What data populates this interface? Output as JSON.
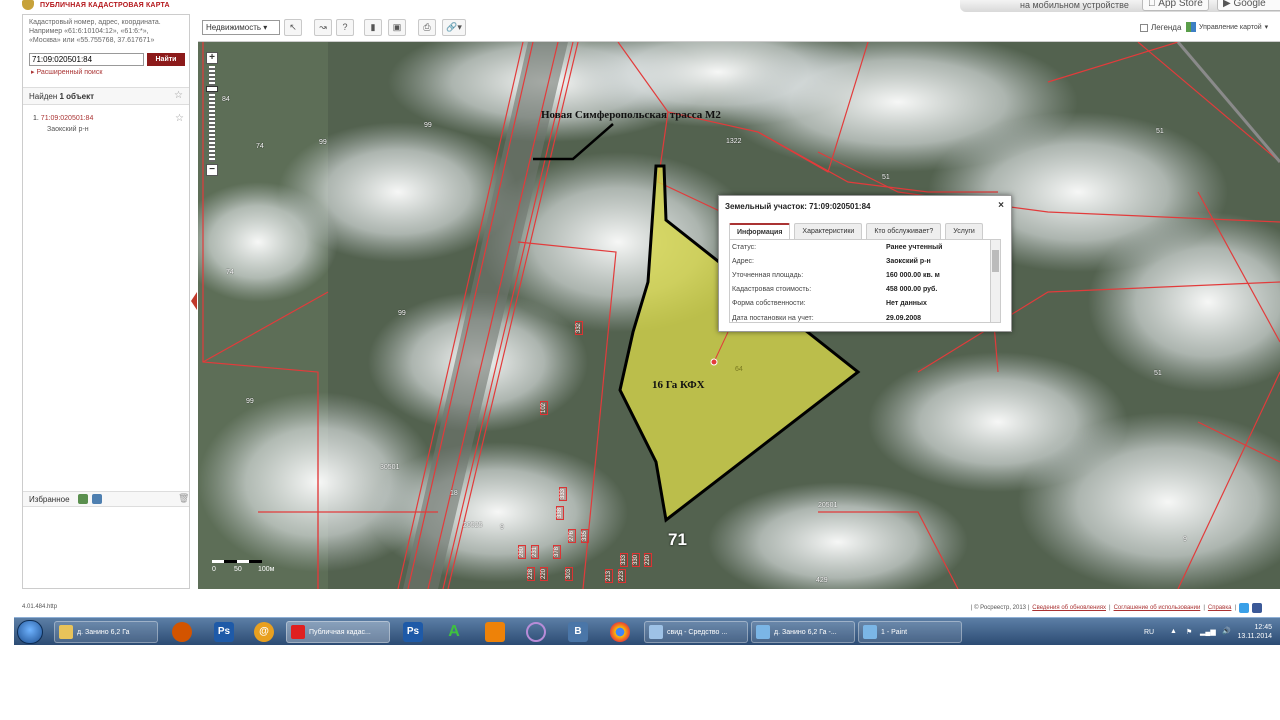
{
  "header": {
    "logo_text": "ПУБЛИЧНАЯ КАДАСТРОВАЯ КАРТА",
    "mobile_text": "на мобильном устройстве",
    "appstore_label": "App Store",
    "googleplay_label": "Google play"
  },
  "search": {
    "hint_line1": "Кадастровый номер, адрес, координата.",
    "hint_line2": "Например «61:6:10104:12», «61:6:*»,",
    "hint_line3": "«Москва» или «55.755768, 37.617671»",
    "value": "71:09:020501:84",
    "button_label": "Найти",
    "advanced_label": "Расширенный поиск"
  },
  "results": {
    "found_prefix": "Найден ",
    "found_count": "1 объект",
    "item_index": "1.",
    "item_number": "71:09:020501:84",
    "item_region": "Заокский р-н"
  },
  "favorites": {
    "label": "Избранное"
  },
  "toolbar": {
    "realty_select": "Недвижимость",
    "legend_label": "Легенда",
    "map_manage_label": "Управление картой"
  },
  "map": {
    "road_label": "Новая Симферопольская трасса М2",
    "plot_label": "16 Га КФХ",
    "district_label": "71",
    "cad_numbers": [
      "84",
      "74",
      "99",
      "99",
      "1322",
      "51",
      "51",
      "74",
      "99",
      "99",
      "30501",
      "18",
      "20525",
      "9",
      "20501",
      "429",
      "9",
      "64"
    ],
    "small_plots": [
      "332",
      "102",
      "333",
      "338",
      "276",
      "335",
      "280",
      "231",
      "378",
      "228",
      "220",
      "303",
      "333",
      "330",
      "220",
      "213",
      "223"
    ],
    "scale_labels": [
      "0",
      "50",
      "100м"
    ]
  },
  "popup": {
    "title": "Земельный участок: 71:09:020501:84",
    "close_label": "×",
    "tabs": [
      "Информация",
      "Характеристики",
      "Кто обслуживает?",
      "Услуги"
    ],
    "rows": [
      {
        "label": "Статус:",
        "value": "Ранее учтенный"
      },
      {
        "label": "Адрес:",
        "value": "Заокский р-н"
      },
      {
        "label": "Уточненная площадь:",
        "value": "160 000.00 кв. м"
      },
      {
        "label": "Кадастровая стоимость:",
        "value": "458 000.00 руб."
      },
      {
        "label": "Форма собственности:",
        "value": "Нет данных"
      },
      {
        "label": "Дата постановки на учет:",
        "value": "29.09.2008"
      }
    ]
  },
  "statusline": {
    "version": "4.01.484.http",
    "copyright": "| © Росреестр, 2013 |",
    "link1": "Сведения об обновлениях",
    "link2": "Соглашение об использовании",
    "link3": "Справка"
  },
  "taskbar": {
    "apps": [
      "д. Занино 6,2 Га",
      "Публичная кадас...",
      "свид - Средство ...",
      "д. Занино 6,2 Га -...",
      "1 - Paint"
    ],
    "lang": "RU",
    "time": "12:45",
    "date": "13.11.2014"
  },
  "colors": {
    "brand_red": "#b4161b",
    "plot_fill": "#d6d64a",
    "boundary_red": "#e23b3b"
  }
}
